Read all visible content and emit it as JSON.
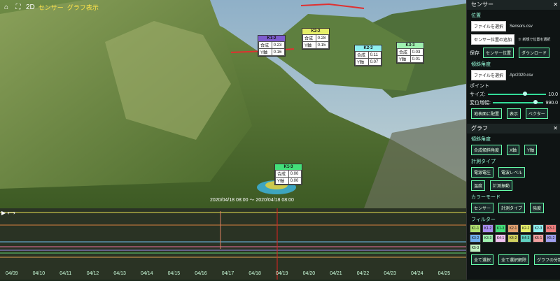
{
  "toolbar": {
    "mode": "2D",
    "labels": [
      "センサー",
      "グラフ表示"
    ]
  },
  "sensors": [
    {
      "id": "K1-2",
      "color": "#7e5ccf",
      "rows": [
        [
          "合成",
          "0.23"
        ],
        [
          "Y軸",
          "0.16"
        ]
      ]
    },
    {
      "id": "K2-2",
      "color": "#e6ef6a",
      "rows": [
        [
          "合成",
          "0.28"
        ],
        [
          "Y軸",
          "0.15"
        ]
      ]
    },
    {
      "id": "K2-3",
      "color": "#8ff0f0",
      "rows": [
        [
          "合成",
          "0.11"
        ],
        [
          "Y軸",
          "0.07"
        ]
      ]
    },
    {
      "id": "K3-3",
      "color": "#9ff0b0",
      "rows": [
        [
          "合成",
          "0.03"
        ],
        [
          "Y軸",
          "0.01"
        ]
      ]
    },
    {
      "id": "K1-3",
      "color": "#43e07a",
      "rows": [
        [
          "合成",
          "0.00"
        ],
        [
          "Y軸",
          "0.00"
        ]
      ]
    }
  ],
  "timestamp": "2020/04/18 08:00 ～ 2020/04/18 08:00",
  "timeline": {
    "dates": [
      "04/09",
      "04/10",
      "04/11",
      "04/12",
      "04/13",
      "04/14",
      "04/15",
      "04/16",
      "04/17",
      "04/18",
      "04/19",
      "04/20",
      "04/21",
      "04/22",
      "04/23",
      "04/24",
      "04/25"
    ]
  },
  "panel": {
    "sensor_title": "センサー",
    "position_label": "位置",
    "file_btn": "ファイルを選択",
    "file_name": "Sensors.csv",
    "add_btn": "センサー位置の追加",
    "add_note": "※ 新規で位置を選択",
    "save_label": "保存",
    "save_btn": "センサー位置",
    "download_btn": "ダウンロード",
    "tilt_label": "傾斜角度",
    "tilt_file_btn": "ファイルを選択",
    "tilt_file_name": "Apr2020.csv",
    "point_label": "ポイント",
    "size_label": "サイズ:",
    "size_value": "10.0",
    "disp_label": "変位増幅:",
    "disp_value": "990.0",
    "buttons": [
      "地表面に配置",
      "表示",
      "ベクター"
    ],
    "graph_title": "グラフ",
    "graph_tilt_label": "傾斜角度",
    "graph_tilt_btns": [
      "合成傾斜角度",
      "X軸",
      "Y軸"
    ],
    "measure_label": "計測タイプ",
    "measure_btns": [
      "電源電圧",
      "電波レベル",
      "温度",
      "計測振動"
    ],
    "color_label": "カラーモード",
    "color_btns": [
      "センサー",
      "計測タイプ",
      "強度"
    ],
    "filter_label": "フィルター",
    "filters": [
      "K1-1",
      "K1-2",
      "K1-3",
      "K2-1",
      "K2-2",
      "K2-3",
      "K3-1",
      "K3-2",
      "K3-3",
      "K4-1",
      "K4-2",
      "K4-3",
      "K5-1",
      "K5-2",
      "K5-3"
    ],
    "filter_colors": [
      "#b0e070",
      "#a98ef0",
      "#43e07a",
      "#e0a070",
      "#e6ef6a",
      "#8ff0f0",
      "#f08080",
      "#70b0f0",
      "#9ff0b0",
      "#f0c0f0",
      "#d0d060",
      "#60d0c0",
      "#f0a0a0",
      "#a0a0f0",
      "#c0f0c0"
    ],
    "bottom_btns": [
      "全て選択",
      "全て選択解除",
      "グラフの分類"
    ]
  }
}
